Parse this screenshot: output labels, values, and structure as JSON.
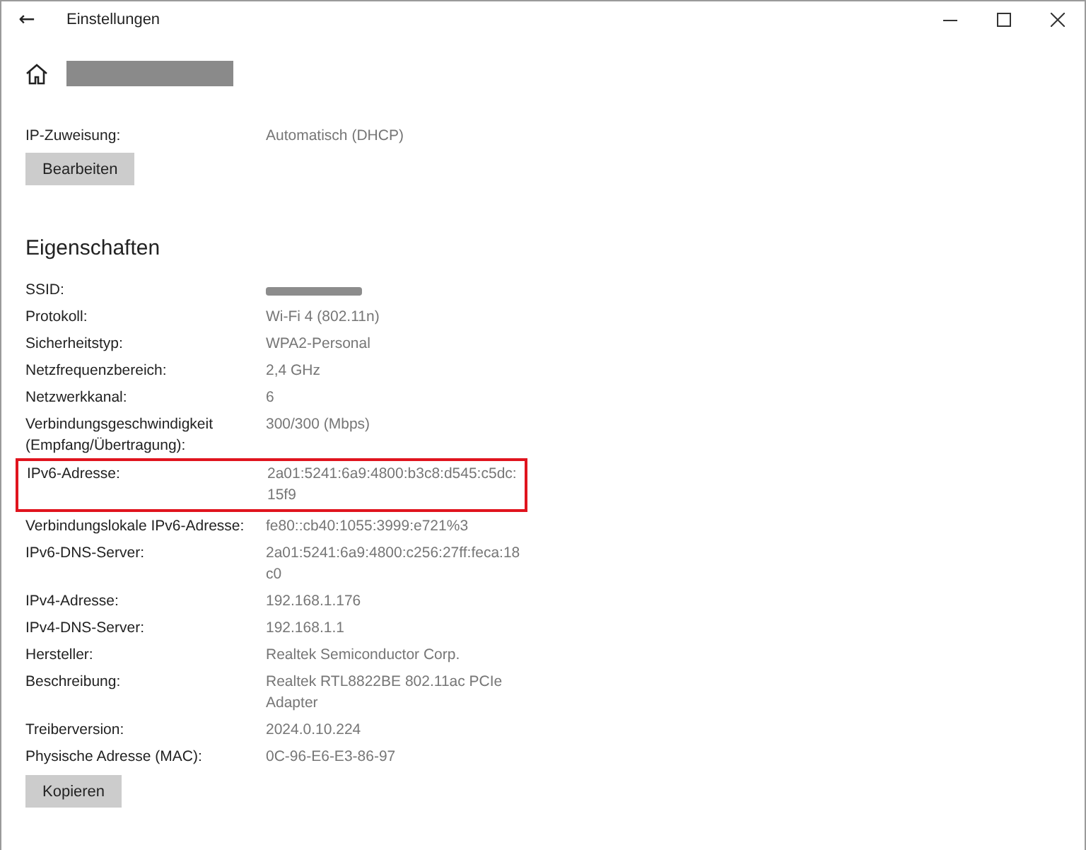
{
  "window": {
    "title": "Einstellungen",
    "back_button": "←"
  },
  "network_name": {
    "redacted": true
  },
  "ip_assignment": {
    "label": "IP-Zuweisung:",
    "value": "Automatisch (DHCP)",
    "button": "Bearbeiten"
  },
  "properties": {
    "title": "Eigenschaften",
    "rows": [
      {
        "label": "SSID:",
        "kind": "redacted",
        "highlighted": false
      },
      {
        "label": "Protokoll:",
        "value": "Wi-Fi 4 (802.11n)",
        "highlighted": false
      },
      {
        "label": "Sicherheitstyp:",
        "value": "WPA2-Personal",
        "highlighted": false
      },
      {
        "label": "Netzfrequenzbereich:",
        "value": "2,4 GHz",
        "highlighted": false
      },
      {
        "label": "Netzwerkkanal:",
        "value": "6",
        "highlighted": false
      },
      {
        "label": "Verbindungsgeschwindigkeit\n(Empfang/Übertragung):",
        "value": "300/300 (Mbps)",
        "highlighted": false
      },
      {
        "label": "IPv6-Adresse:",
        "value": "2a01:5241:6a9:4800:b3c8:d545:c5dc:\n15f9",
        "highlighted": true
      },
      {
        "label": "Verbindungslokale IPv6-Adresse:",
        "value": "fe80::cb40:1055:3999:e721%3",
        "highlighted": false
      },
      {
        "label": "IPv6-DNS-Server:",
        "value": "2a01:5241:6a9:4800:c256:27ff:feca:18\nc0",
        "highlighted": false
      },
      {
        "label": "IPv4-Adresse:",
        "value": "192.168.1.176",
        "highlighted": false
      },
      {
        "label": "IPv4-DNS-Server:",
        "value": "192.168.1.1",
        "highlighted": false
      },
      {
        "label": "Hersteller:",
        "value": "Realtek Semiconductor Corp.",
        "highlighted": false
      },
      {
        "label": "Beschreibung:",
        "value": "Realtek RTL8822BE 802.11ac PCIe\nAdapter",
        "highlighted": false
      },
      {
        "label": "Treiberversion:",
        "value": "2024.0.10.224",
        "highlighted": false
      },
      {
        "label": "Physische Adresse (MAC):",
        "value": "0C-96-E6-E3-86-97",
        "highlighted": false
      }
    ],
    "button": "Kopieren"
  }
}
